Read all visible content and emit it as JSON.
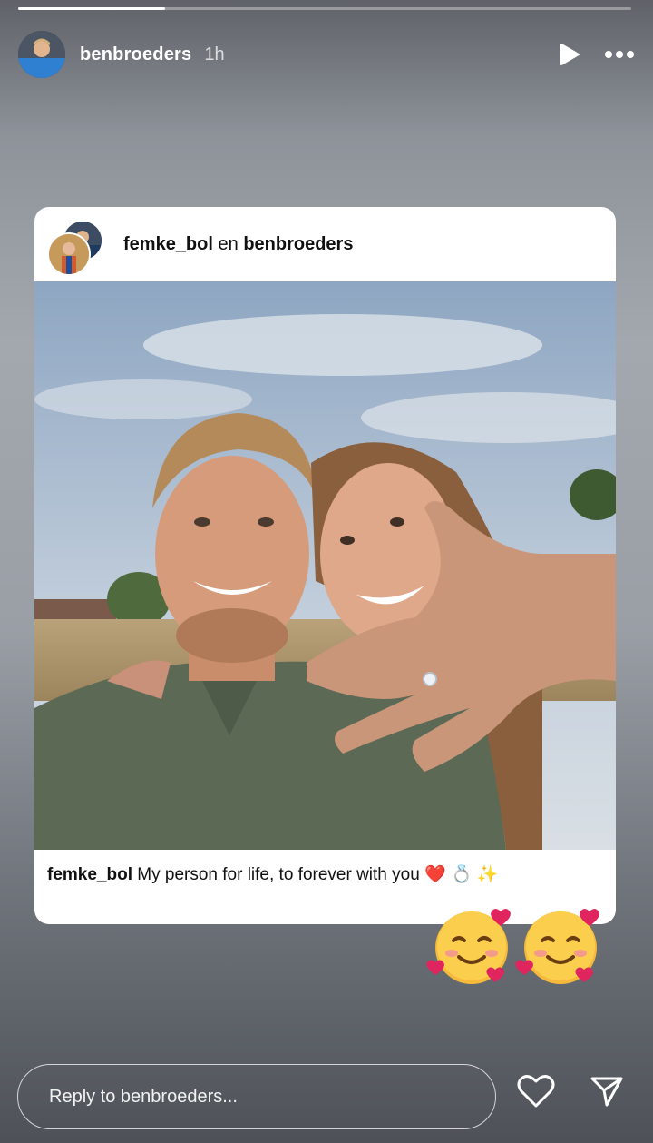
{
  "story": {
    "progress_fraction": 0.24
  },
  "header": {
    "username": "benbroeders",
    "timestamp": "1h",
    "play_icon": "play-icon",
    "more_icon": "more-horizontal-icon"
  },
  "post": {
    "author_1": "femke_bol",
    "connector": "en",
    "author_2": "benbroeders",
    "caption_user": "femke_bol",
    "caption_text": "My person for life, to forever with you",
    "caption_emoji": "❤️ 💍 ✨"
  },
  "stickers": {
    "emoji": "smiling-face-with-hearts"
  },
  "footer": {
    "reply_placeholder": "Reply to benbroeders...",
    "like_icon": "heart-icon",
    "send_icon": "send-icon"
  },
  "colors": {
    "card_bg": "#ffffff",
    "heart_red": "#e0245e"
  }
}
